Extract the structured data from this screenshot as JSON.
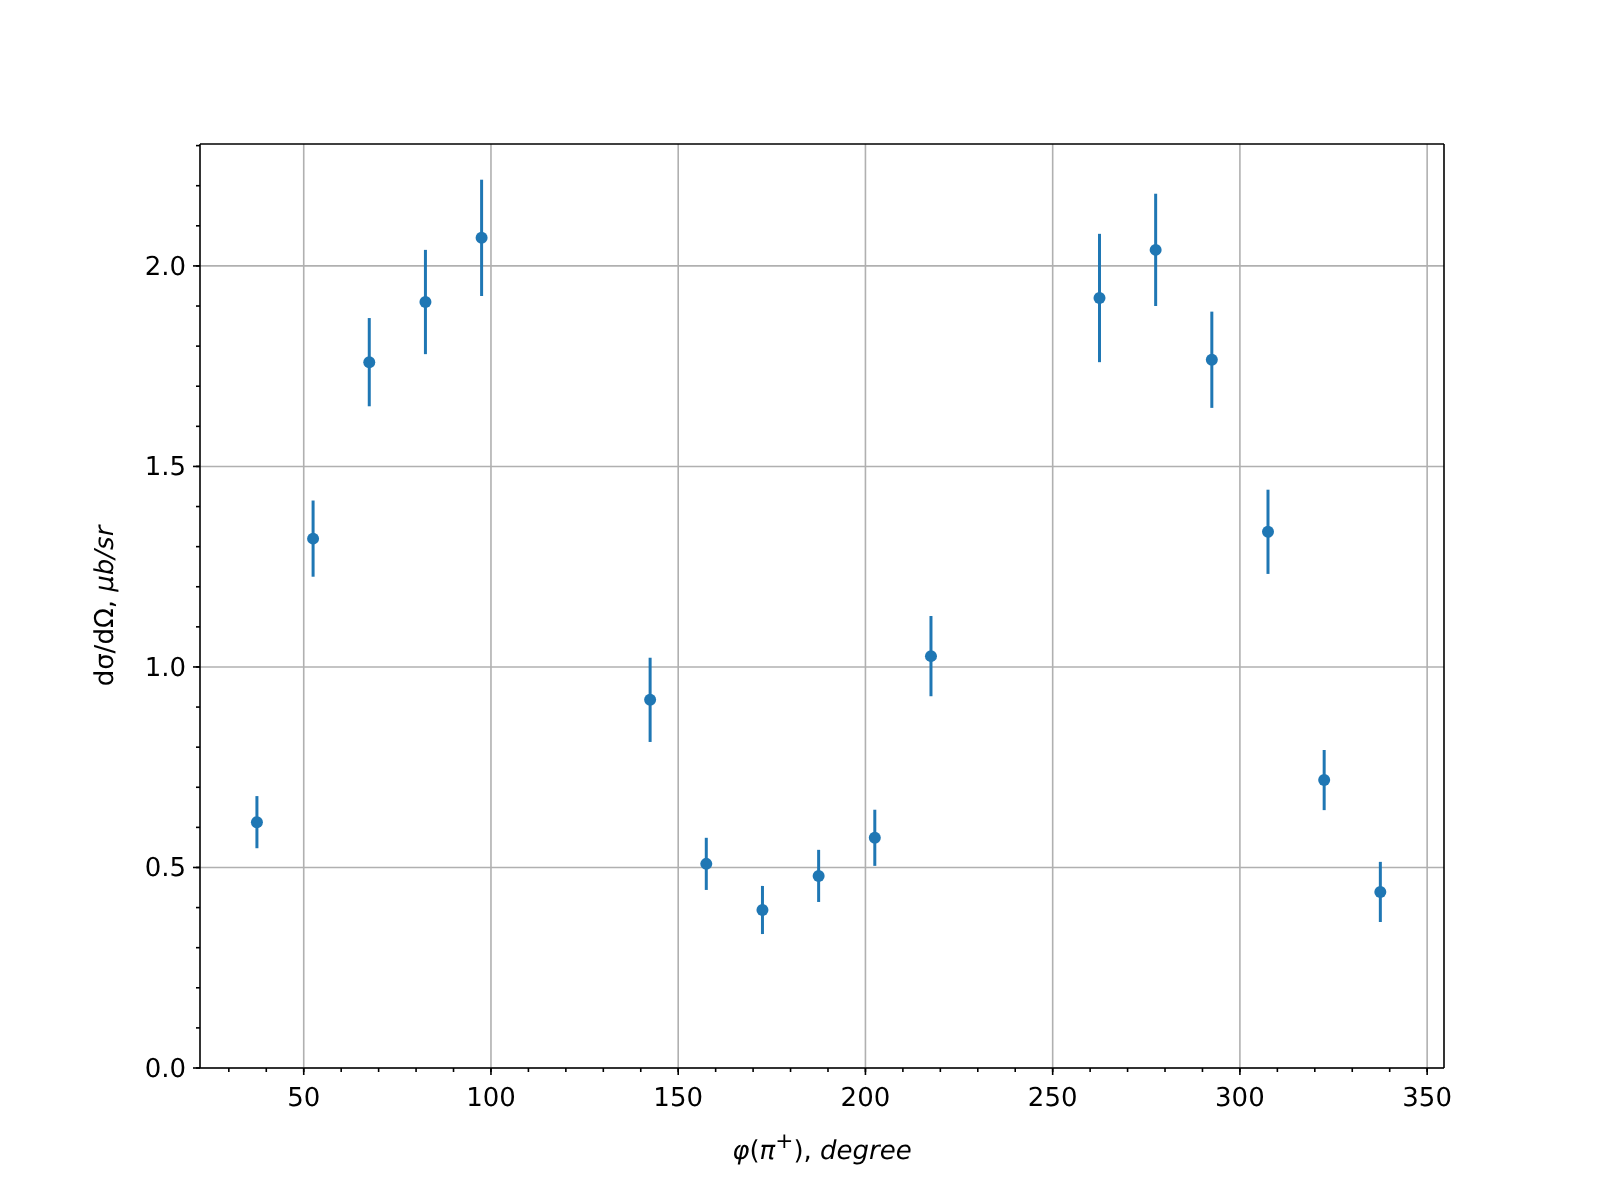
{
  "chart": {
    "chart_data": {
      "type": "scatter",
      "xlabel": "*φ*(*π*$^{+}$), *degree*",
      "ylabel": "dσ/dΩ, *μb/sr*",
      "x": [
        37.5,
        52.5,
        67.5,
        82.5,
        97.5,
        142.5,
        157.5,
        172.5,
        187.5,
        202.5,
        217.5,
        262.5,
        277.5,
        292.5,
        307.5,
        322.5,
        337.5
      ],
      "grid": true,
      "series": [
        {
          "color": "#1f77b4",
          "values": [
            0.613,
            1.32,
            1.76,
            1.91,
            2.07,
            0.918,
            0.509,
            0.394,
            0.479,
            0.574,
            1.027,
            1.92,
            2.04,
            1.766,
            1.337,
            0.718,
            0.439
          ],
          "errors": [
            0.065,
            0.095,
            0.11,
            0.13,
            0.145,
            0.105,
            0.065,
            0.06,
            0.065,
            0.07,
            0.1,
            0.16,
            0.14,
            0.12,
            0.105,
            0.075,
            0.075
          ]
        }
      ],
      "xlim": [
        22.3,
        354.5
      ],
      "ylim": [
        0,
        2.304
      ],
      "xticks": [
        50,
        100,
        150,
        200,
        250,
        300,
        350
      ],
      "yticks": [
        {
          "value": 0,
          "label": "0.0"
        },
        {
          "value": 0.5,
          "label": "0.5"
        },
        {
          "value": 1,
          "label": "1.0"
        },
        {
          "value": 1.5,
          "label": "1.5"
        },
        {
          "value": 2,
          "label": "2.0"
        }
      ]
    }
  }
}
